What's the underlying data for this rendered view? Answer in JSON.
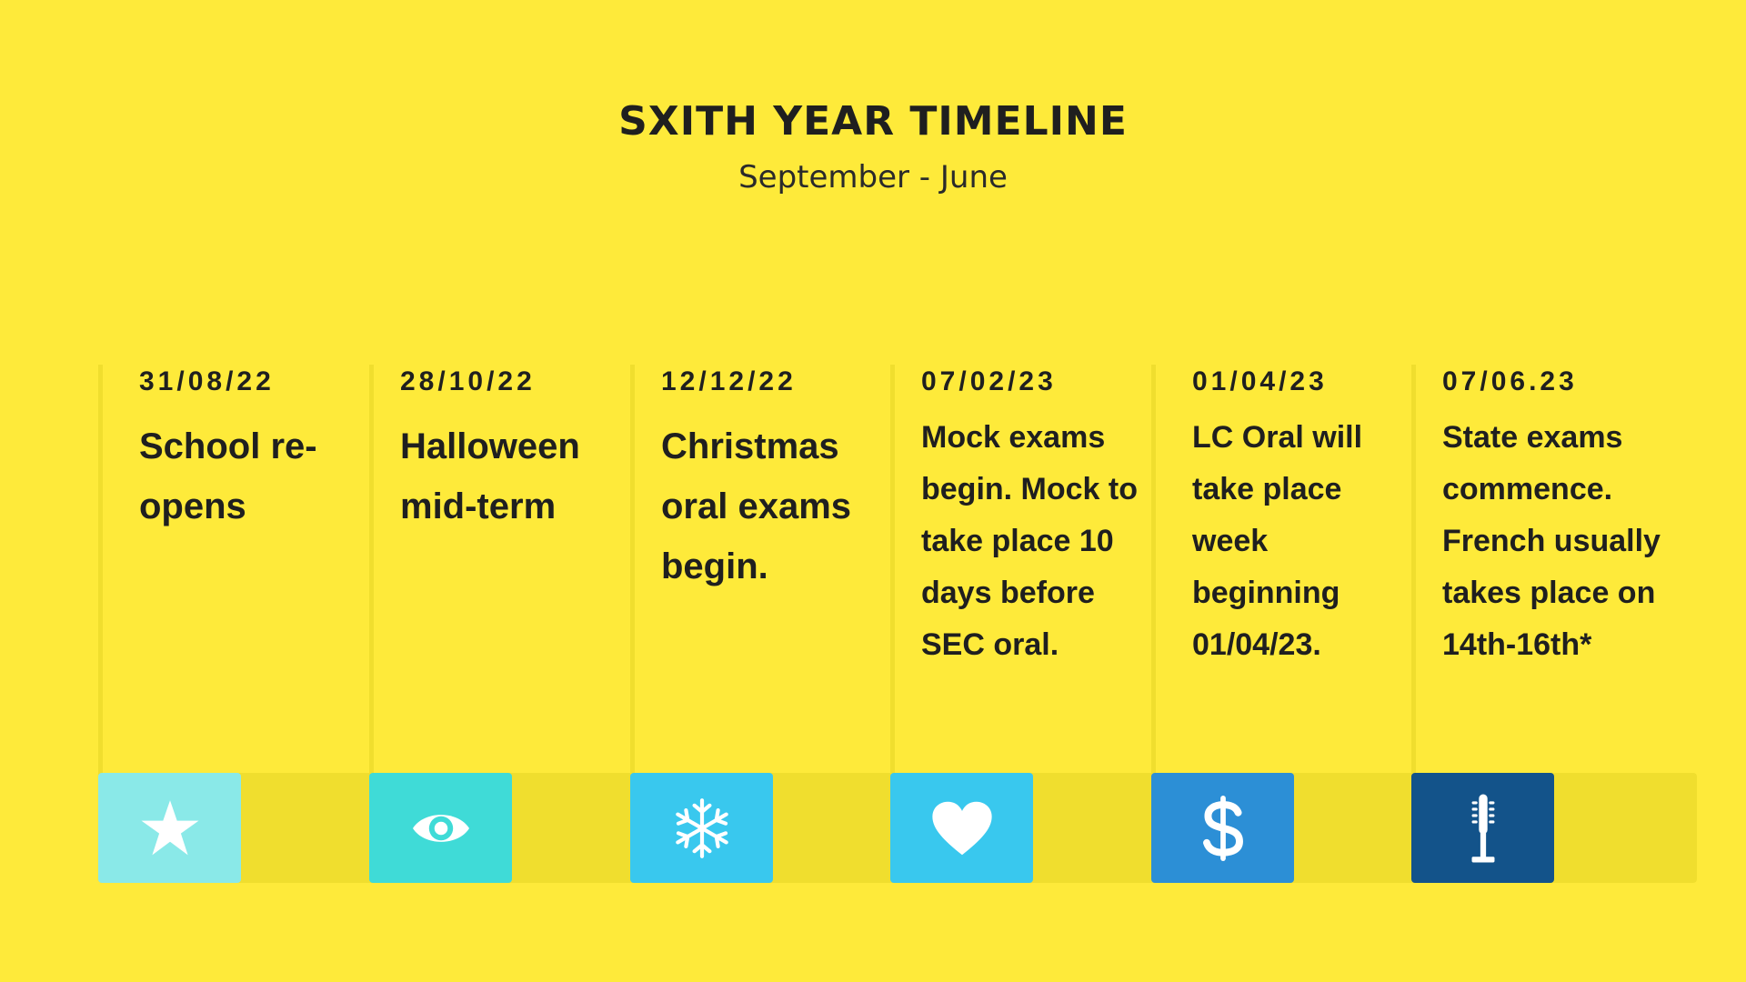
{
  "header": {
    "title": "SXITH YEAR TIMELINE",
    "subtitle": "September - June"
  },
  "events": [
    {
      "date": "31/08/22",
      "text": "School re-opens",
      "icon": "star-icon",
      "color": "#8AE9E8"
    },
    {
      "date": "28/10/22",
      "text": "Halloween mid-term",
      "icon": "eye-icon",
      "color": "#3FDBD7"
    },
    {
      "date": "12/12/22",
      "text": "Christmas oral exams begin.",
      "icon": "snowflake-icon",
      "color": "#39C8EE"
    },
    {
      "date": "07/02/23",
      "text": "Mock exams begin. Mock to take place 10 days before SEC oral.",
      "icon": "heart-icon",
      "color": "#39C8EE"
    },
    {
      "date": "01/04/23",
      "text": "LC Oral will take place week beginning 01/04/23.",
      "icon": "dollar-icon",
      "color": "#2C8FD6"
    },
    {
      "date": "07/06.23",
      "text": "State exams commence. French usually takes place on 14th-16th*",
      "icon": "fountain-icon",
      "color": "#13538A"
    }
  ],
  "colors": {
    "background": "#FEEA3A",
    "band": "#F0DE2E",
    "text": "#1f1f1f"
  }
}
